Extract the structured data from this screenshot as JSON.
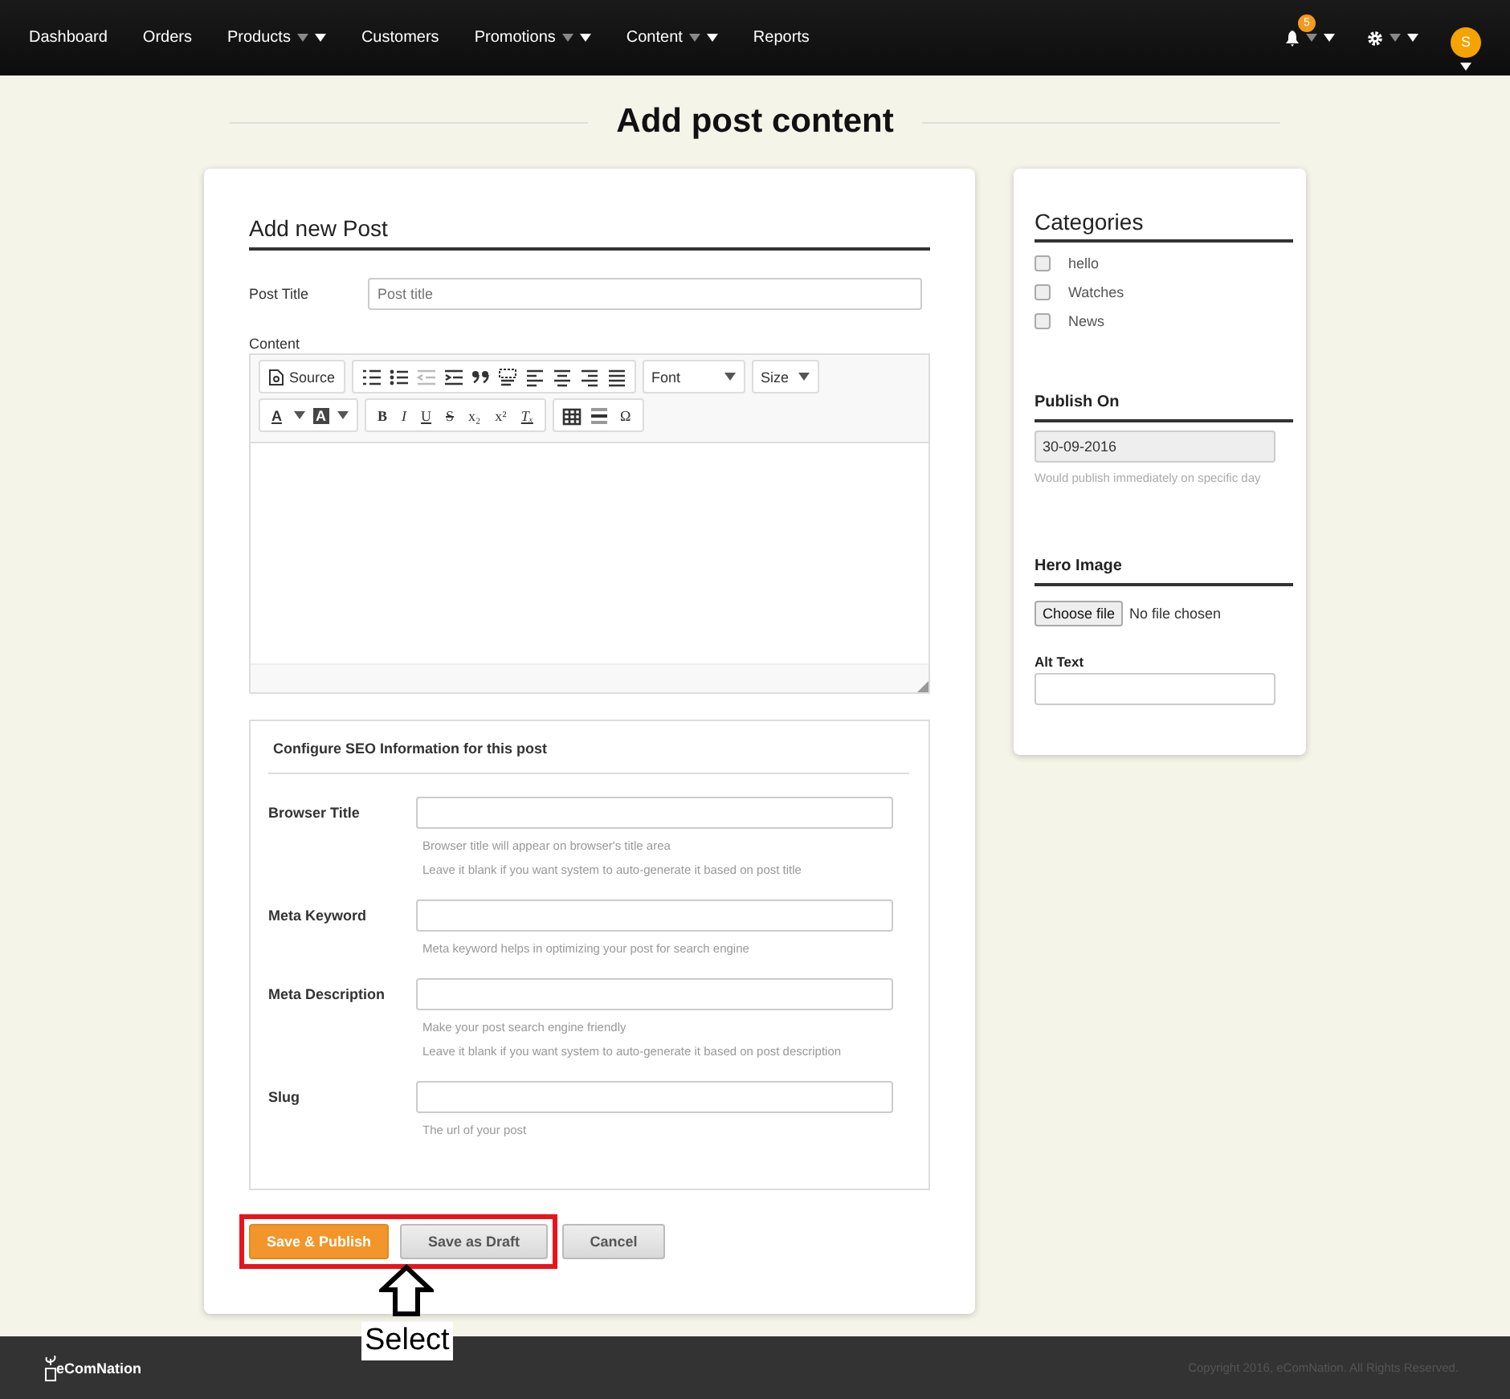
{
  "nav": {
    "items": [
      {
        "label": "Dashboard",
        "dropdown": false
      },
      {
        "label": "Orders",
        "dropdown": false
      },
      {
        "label": "Products",
        "dropdown": true
      },
      {
        "label": "Customers",
        "dropdown": false
      },
      {
        "label": "Promotions",
        "dropdown": true
      },
      {
        "label": "Content",
        "dropdown": true
      },
      {
        "label": "Reports",
        "dropdown": false
      }
    ],
    "notification_count": "5",
    "avatar_initial": "S"
  },
  "page_title": "Add post content",
  "form": {
    "heading": "Add new Post",
    "post_title": {
      "label": "Post Title",
      "placeholder": "Post title"
    },
    "content_label": "Content",
    "toolbar": {
      "source": "Source",
      "font": "Font",
      "size": "Size",
      "color_buttons": [
        "A",
        "A"
      ],
      "format_buttons": [
        "B",
        "I",
        "U",
        "S",
        "x₂",
        "x²",
        "Tₓ"
      ],
      "special_char": "Ω"
    },
    "seo": {
      "heading": "Configure SEO Information for this post",
      "fields": [
        {
          "label": "Browser Title",
          "hints": [
            "Browser title will appear on browser's title area",
            "Leave it blank if you want system to auto-generate it based on post title"
          ]
        },
        {
          "label": "Meta Keyword",
          "hints": [
            "Meta keyword helps in optimizing your post for search engine"
          ]
        },
        {
          "label": "Meta Description",
          "hints": [
            "Make your post search engine friendly",
            "Leave it blank if you want system to auto-generate it based on post description"
          ]
        },
        {
          "label": "Slug",
          "hints": [
            "The url of your post"
          ]
        }
      ]
    },
    "buttons": [
      {
        "label": "Save & Publish",
        "kind": "primary",
        "highlighted": true
      },
      {
        "label": "Save as Draft",
        "kind": "default",
        "highlighted": true
      },
      {
        "label": "Cancel",
        "kind": "default",
        "highlighted": false
      }
    ]
  },
  "sidebar": {
    "categories_heading": "Categories",
    "categories": [
      {
        "label": "hello",
        "checked": false
      },
      {
        "label": "Watches",
        "checked": false
      },
      {
        "label": "News",
        "checked": false
      }
    ],
    "publish_heading": "Publish On",
    "publish_date": "30-09-2016",
    "publish_hint": "Would publish immediately on specific day",
    "hero_heading": "Hero Image",
    "file_button": "Choose file",
    "file_status": "No file chosen",
    "alt_label": "Alt Text"
  },
  "annotation": {
    "label": "Select"
  },
  "footer": {
    "brand": "eComNation",
    "copyright": "Copyright 2016, eComNation. All Rights Reserved."
  }
}
